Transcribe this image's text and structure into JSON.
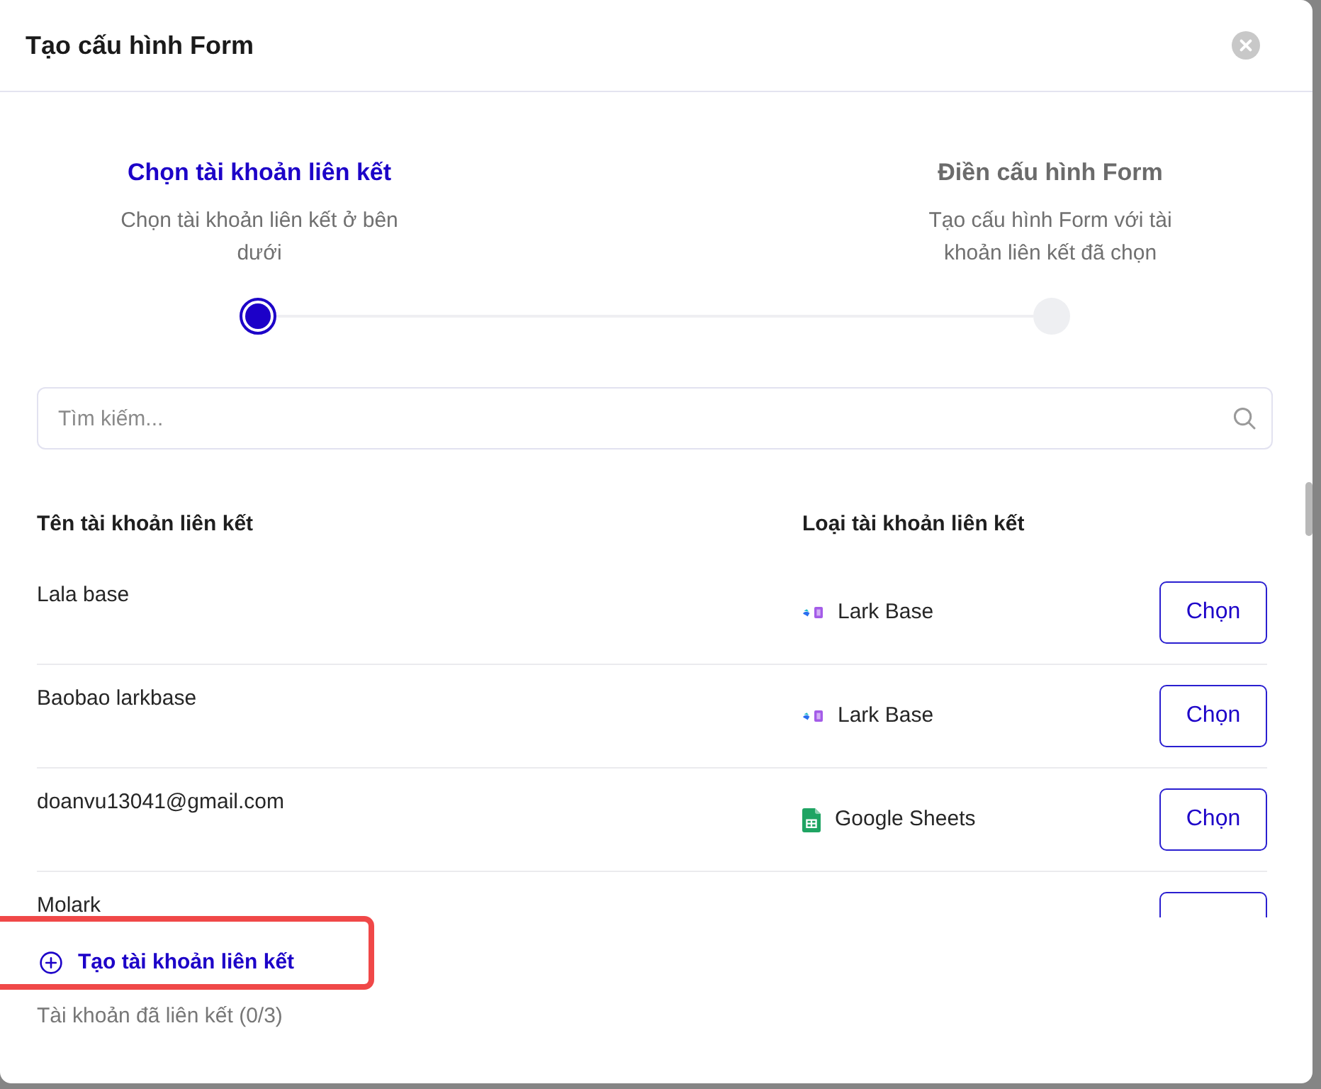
{
  "dialog": {
    "title": "Tạo cấu hình Form"
  },
  "steps": [
    {
      "title": "Chọn tài khoản liên kết",
      "description": "Chọn tài khoản liên kết ở bên dưới",
      "selected": true
    },
    {
      "title": "Điền cấu hình Form",
      "description": "Tạo cấu hình Form với tài khoản liên kết đã chọn",
      "selected": false
    }
  ],
  "search": {
    "placeholder": "Tìm kiếm..."
  },
  "table": {
    "columns": [
      "Tên tài khoản liên kết",
      "Loại tài khoản liên kết"
    ],
    "rows": [
      {
        "name": "Lala base",
        "type": {
          "kind": "lark_base",
          "label": "Lark Base"
        },
        "action": "Chọn"
      },
      {
        "name": "Baobao larkbase",
        "type": {
          "kind": "lark_base",
          "label": "Lark Base"
        },
        "action": "Chọn"
      },
      {
        "name": "doanvu13041@gmail.com",
        "type": {
          "kind": "google_sheets",
          "label": "Google Sheets"
        },
        "action": "Chọn"
      },
      {
        "name": "Molark"
      }
    ]
  },
  "create_link": {
    "label": "Tạo tài khoản liên kết",
    "highlighted": true
  },
  "footer_note": "Tài khoản đã liên kết (0/3)"
}
